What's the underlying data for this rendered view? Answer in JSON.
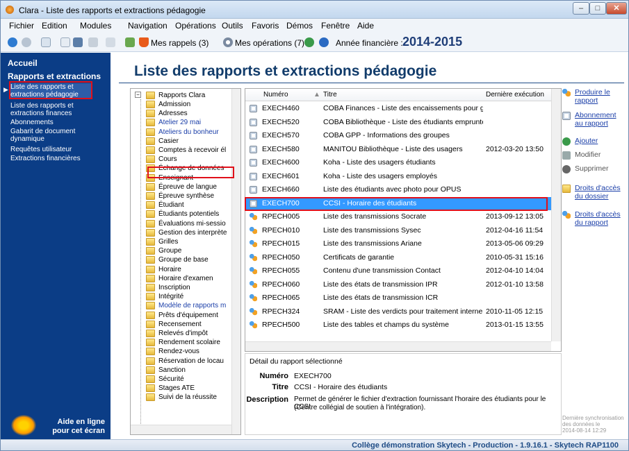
{
  "window": {
    "title": "Clara - Liste des rapports et extractions pédagogie"
  },
  "menu": [
    "Fichier",
    "Edition",
    "Modules",
    "Navigation",
    "Opérations",
    "Outils",
    "Favoris",
    "Démos",
    "Fenêtre",
    "Aide"
  ],
  "toolbar": {
    "rappels": "Mes rappels (3)",
    "operations": "Mes opérations (7)",
    "annee_label": "Année financière :",
    "annee_value": "2014-2015"
  },
  "nav": {
    "accueil": "Accueil",
    "section": "Rapports et extractions",
    "items": [
      "Liste des rapports et extractions pédagogie",
      "Liste des rapports et extractions finances",
      "Abonnements",
      "Gabarit de document dynamique",
      "Requêtes utilisateur",
      "Extractions financières"
    ],
    "aide": "Aide en ligne pour cet écran"
  },
  "page_title": "Liste des rapports et extractions pédagogie",
  "tree": {
    "root": "Rapports Clara",
    "items": [
      "Admission",
      "Adresses",
      "Atelier 29 mai",
      "Ateliers du bonheur",
      "Casier",
      "Comptes à recevoir él",
      "Cours",
      "Échange de données",
      "Enseignant",
      "Épreuve de langue",
      "Épreuve synthèse",
      "Étudiant",
      "Étudiants potentiels",
      "Évaluations mi-sessio",
      "Gestion des interprète",
      "Grilles",
      "Groupe",
      "Groupe de base",
      "Horaire",
      "Horaire d'examen",
      "Inscription",
      "Intégrité",
      "Modèle de rapports m",
      "Prêts d'équipement",
      "Recensement",
      "Relevés d'impôt",
      "Rendement scolaire",
      "Rendez-vous",
      "Réservation de locau",
      "Sanction",
      "Sécurité",
      "Stages ATE",
      "Suivi de la réussite"
    ],
    "blue_items": [
      "Atelier 29 mai",
      "Ateliers du bonheur",
      "Modèle de rapports m"
    ],
    "selected": "Échange de données"
  },
  "table": {
    "headers": {
      "numero": "Numéro",
      "titre": "Titre",
      "derniere": "Dernière exécution"
    },
    "rows": [
      {
        "icon": "doc",
        "numero": "EXECH460",
        "titre": "COBA Finances - Liste des encaissements pour gra...",
        "date": ""
      },
      {
        "icon": "doc",
        "numero": "EXECH520",
        "titre": "COBA Bibliothèque - Liste des étudiants emprunteurs",
        "date": ""
      },
      {
        "icon": "doc",
        "numero": "EXECH570",
        "titre": "COBA GPP - Informations des groupes",
        "date": ""
      },
      {
        "icon": "doc",
        "numero": "EXECH580",
        "titre": "MANITOU Bibliothèque - Liste des usagers",
        "date": "2012-03-20 13:50"
      },
      {
        "icon": "doc",
        "numero": "EXECH600",
        "titre": "Koha - Liste des usagers étudiants",
        "date": ""
      },
      {
        "icon": "doc",
        "numero": "EXECH601",
        "titre": "Koha - Liste des usagers employés",
        "date": ""
      },
      {
        "icon": "doc",
        "numero": "EXECH660",
        "titre": "Liste des étudiants avec photo pour OPUS",
        "date": ""
      },
      {
        "icon": "doc",
        "numero": "EXECH700",
        "titre": "CCSI - Horaire des étudiants",
        "date": "",
        "selected": true
      },
      {
        "icon": "ppl",
        "numero": "RPECH005",
        "titre": "Liste des transmissions Socrate",
        "date": "2013-09-12 13:05"
      },
      {
        "icon": "ppl",
        "numero": "RPECH010",
        "titre": "Liste des transmissions Sysec",
        "date": "2012-04-16 11:54"
      },
      {
        "icon": "ppl",
        "numero": "RPECH015",
        "titre": "Liste des transmissions Ariane",
        "date": "2013-05-06 09:29"
      },
      {
        "icon": "ppl",
        "numero": "RPECH050",
        "titre": "Certificats de garantie",
        "date": "2010-05-31 15:16"
      },
      {
        "icon": "ppl",
        "numero": "RPECH055",
        "titre": "Contenu d'une transmission Contact",
        "date": "2012-04-10 14:04"
      },
      {
        "icon": "ppl",
        "numero": "RPECH060",
        "titre": "Liste des états de transmission IPR",
        "date": "2012-01-10 13:58"
      },
      {
        "icon": "ppl",
        "numero": "RPECH065",
        "titre": "Liste des états de transmission ICR",
        "date": ""
      },
      {
        "icon": "ppl",
        "numero": "RPECH324",
        "titre": "SRAM - Liste des verdicts pour traitement interne",
        "date": "2010-11-05 12:15"
      },
      {
        "icon": "ppl",
        "numero": "RPECH500",
        "titre": "Liste des tables et champs du système",
        "date": "2013-01-15 13:55"
      }
    ]
  },
  "detail": {
    "group": "Détail du rapport sélectionné",
    "numero_label": "Numéro",
    "numero": "EXECH700",
    "titre_label": "Titre",
    "titre": "CCSI - Horaire des étudiants",
    "description_label": "Description",
    "description_l1": "Permet de générer le fichier d'extraction fournissant l'horaire des étudiants pour le CCSI",
    "description_l2": "(Centre collégial de soutien à l'intégration)."
  },
  "actions": {
    "produire": "Produire le rapport",
    "abonnement": "Abonnement au rapport",
    "ajouter": "Ajouter",
    "modifier": "Modifier",
    "supprimer": "Supprimer",
    "droits_dossier": "Droits d'accès du dossier",
    "droits_rapport": "Droits d'accès du rapport"
  },
  "sync": {
    "l1": "Dernière synchronisation",
    "l2": "des données le",
    "l3": "2014-08-14 12:29"
  },
  "status": "Collège démonstration Skytech - Production - 1.9.16.1 - Skytech RAP1100"
}
